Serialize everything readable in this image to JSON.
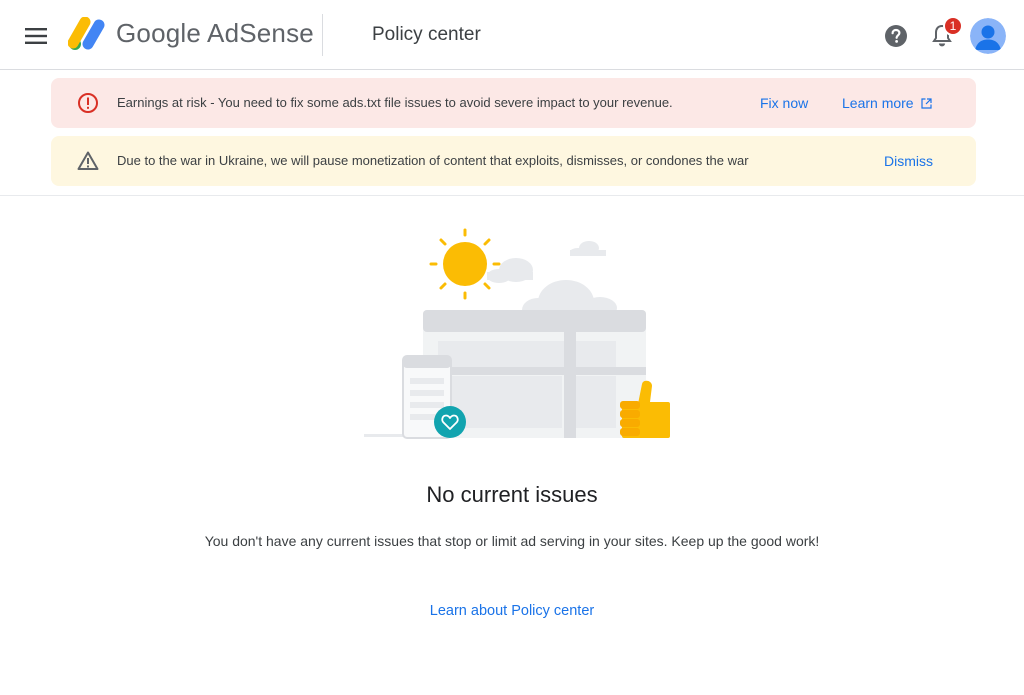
{
  "header": {
    "brand": "Google AdSense",
    "page_title": "Policy center",
    "notification_count": "1"
  },
  "banners": {
    "error": {
      "text": "Earnings at risk - You need to fix some ads.txt file issues to avoid severe impact to your revenue.",
      "fix_label": "Fix now",
      "learn_label": "Learn more"
    },
    "warning": {
      "text": "Due to the war in Ukraine, we will pause monetization of content that exploits, dismisses, or condones the war",
      "dismiss_label": "Dismiss"
    }
  },
  "empty_state": {
    "title": "No current issues",
    "description": "You don't have any current issues that stop or limit ad serving in your sites. Keep up the good work!",
    "link_label": "Learn about Policy center"
  },
  "icons": {
    "menu": "menu-icon",
    "help": "help-icon",
    "notifications": "bell-icon",
    "error": "error-circle-icon",
    "warning": "warning-triangle-icon",
    "external": "open-in-new-icon"
  },
  "colors": {
    "link": "#1a73e8",
    "error_bg": "#fce8e6",
    "warning_bg": "#fef7e0",
    "badge": "#d93025",
    "sun": "#fbbc04",
    "teal": "#12a4af"
  }
}
